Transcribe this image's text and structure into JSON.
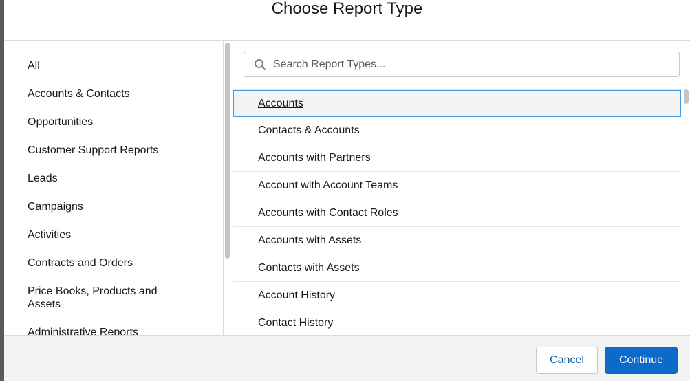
{
  "modal": {
    "title": "Choose Report Type"
  },
  "categories": [
    "All",
    "Accounts & Contacts",
    "Opportunities",
    "Customer Support Reports",
    "Leads",
    "Campaigns",
    "Activities",
    "Contracts and Orders",
    "Price Books, Products and Assets",
    "Administrative Reports"
  ],
  "search": {
    "placeholder": "Search Report Types...",
    "value": "",
    "icon": "search-icon"
  },
  "report_types": [
    "Accounts",
    "Contacts & Accounts",
    "Accounts with Partners",
    "Account with Account Teams",
    "Accounts with Contact Roles",
    "Accounts with Assets",
    "Contacts with Assets",
    "Account History",
    "Contact History"
  ],
  "selected_report_type": "Accounts",
  "footer": {
    "cancel_label": "Cancel",
    "continue_label": "Continue"
  },
  "colors": {
    "primary": "#0b6bcb",
    "selected_border": "#4a9ad9",
    "selected_bg": "#f3f3f3"
  }
}
